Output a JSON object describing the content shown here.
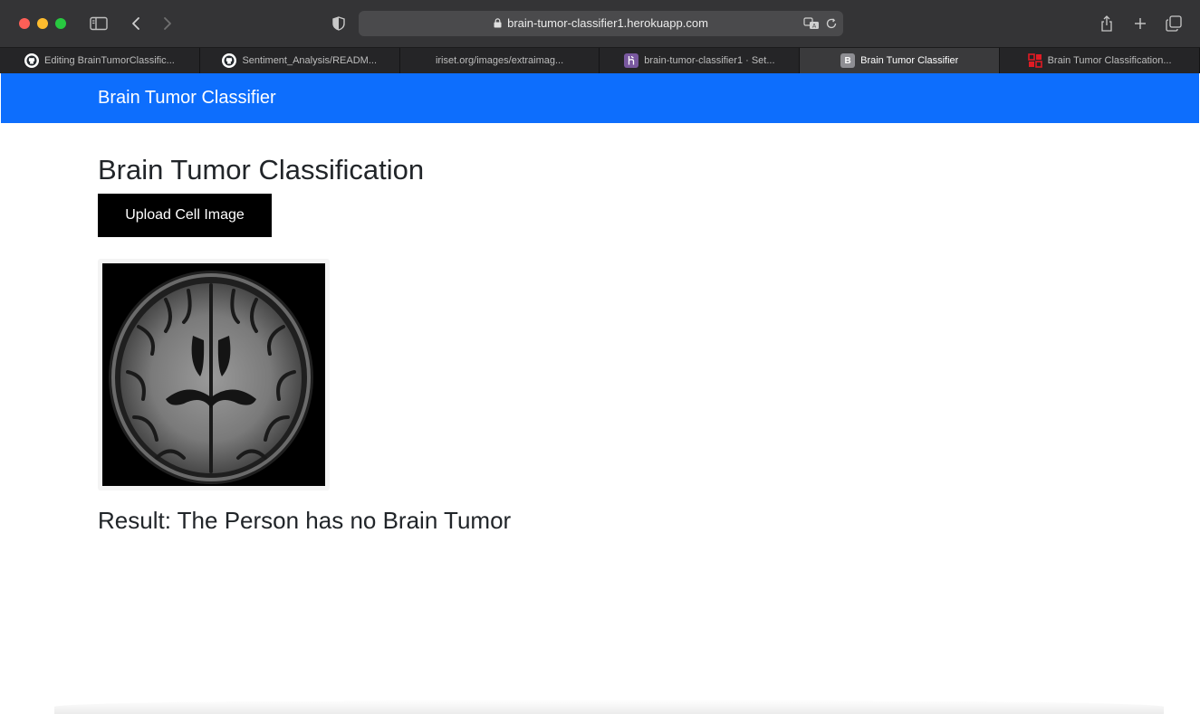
{
  "browser": {
    "address": "brain-tumor-classifier1.herokuapp.com",
    "tabs": [
      {
        "label": "Editing BrainTumorClassific...",
        "icon": "github-icon"
      },
      {
        "label": "Sentiment_Analysis/READM...",
        "icon": "github-icon"
      },
      {
        "label": "iriset.org/images/extraimag...",
        "icon": ""
      },
      {
        "label": "brain-tumor-classifier1 · Set...",
        "icon": "heroku-icon"
      },
      {
        "label": "Brain Tumor Classifier",
        "icon": "bootstrap-icon",
        "badge": "B",
        "active": true
      },
      {
        "label": "Brain Tumor Classification...",
        "icon": "ijert-icon"
      }
    ]
  },
  "navbar": {
    "brand": "Brain Tumor Classifier",
    "color": "#0d6efd"
  },
  "main": {
    "title": "Brain Tumor Classification",
    "upload_label": "Upload Cell Image",
    "result": "Result: The Person has no Brain Tumor"
  }
}
